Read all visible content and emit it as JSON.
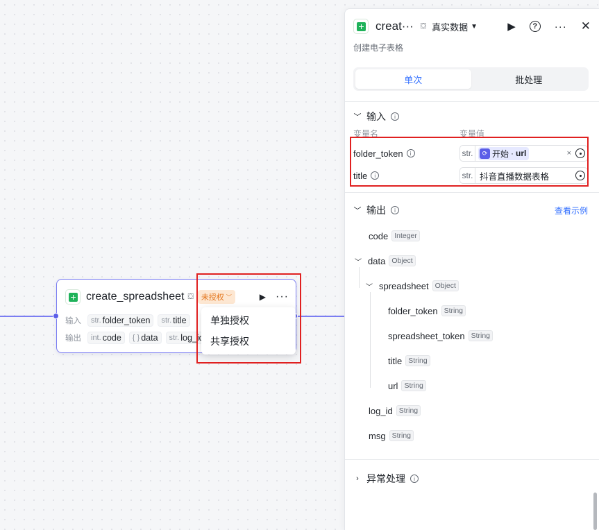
{
  "node": {
    "title": "create_spreadsheet",
    "badge": "未授权",
    "input_label": "输入",
    "output_label": "输出",
    "inputs": [
      {
        "type": "str.",
        "name": "folder_token"
      },
      {
        "type": "str.",
        "name": "title"
      }
    ],
    "outputs": [
      {
        "type": "int.",
        "name": "code"
      },
      {
        "type": "{ }",
        "name": "data"
      },
      {
        "type": "str.",
        "name": "log_id"
      }
    ]
  },
  "dropdown": {
    "items": [
      "单独授权",
      "共享授权"
    ]
  },
  "panel": {
    "title": "creat···",
    "data_mode": "真实数据",
    "description": "创建电子表格",
    "tabs": [
      "单次",
      "批处理"
    ],
    "input_section": {
      "title": "输入",
      "col_name": "变量名",
      "col_value": "变量值",
      "rows": [
        {
          "name": "folder_token",
          "value_type": "str.",
          "ref_source": "开始",
          "ref_sep": " · ",
          "ref_field": "url",
          "clear": "×"
        },
        {
          "name": "title",
          "value_type": "str.",
          "value": "抖音直播数据表格"
        }
      ]
    },
    "output_section": {
      "title": "输出",
      "link": "查看示例",
      "items": [
        {
          "name": "code",
          "type": "Integer"
        },
        {
          "name": "data",
          "type": "Object"
        },
        {
          "name": "spreadsheet",
          "type": "Object"
        },
        {
          "name": "folder_token",
          "type": "String"
        },
        {
          "name": "spreadsheet_token",
          "type": "String"
        },
        {
          "name": "title",
          "type": "String"
        },
        {
          "name": "url",
          "type": "String"
        },
        {
          "name": "log_id",
          "type": "String"
        },
        {
          "name": "msg",
          "type": "String"
        }
      ]
    },
    "error_section": {
      "title": "异常处理"
    }
  },
  "colors": {
    "accent": "#3370ff",
    "node_border": "#7b7ef2",
    "badge_text": "#e37318",
    "badge_bg": "#fde7d2",
    "highlight": "#e02020"
  }
}
